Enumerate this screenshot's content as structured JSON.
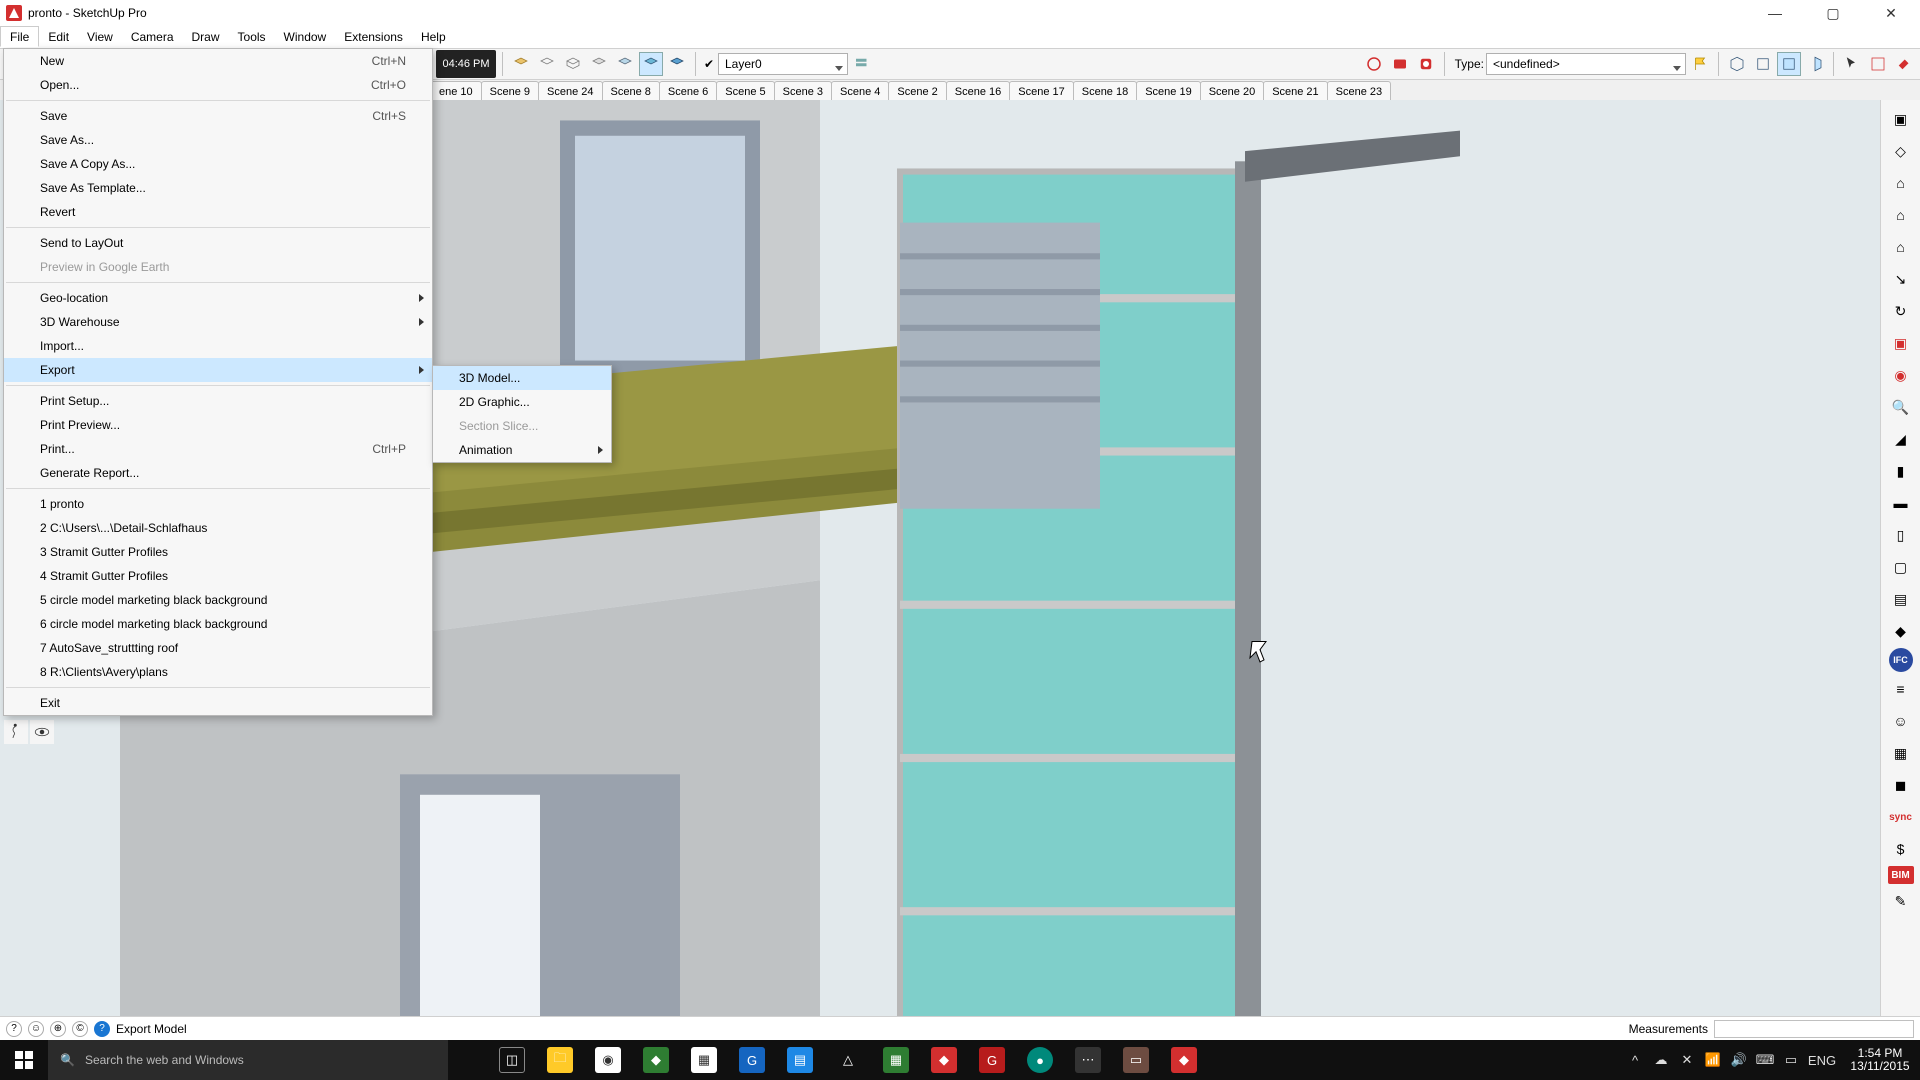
{
  "app": {
    "title": "pronto - SketchUp Pro",
    "status_hint": "Export Model",
    "measurements_label": "Measurements",
    "measurements_value": ""
  },
  "menubar": [
    "File",
    "Edit",
    "View",
    "Camera",
    "Draw",
    "Tools",
    "Window",
    "Extensions",
    "Help"
  ],
  "menubar_active_index": 0,
  "toolbar": {
    "time_display": "04:46 PM",
    "layer_checked": true,
    "layer_label": "Layer0",
    "type_label": "Type:",
    "type_value": "<undefined>"
  },
  "scene_tabs": [
    "ene 10",
    "Scene 9",
    "Scene 24",
    "Scene 8",
    "Scene 6",
    "Scene 5",
    "Scene 3",
    "Scene 4",
    "Scene 2",
    "Scene 16",
    "Scene 17",
    "Scene 18",
    "Scene 19",
    "Scene 20",
    "Scene 21",
    "Scene 23"
  ],
  "file_menu": {
    "groups": [
      [
        {
          "label": "New",
          "shortcut": "Ctrl+N"
        },
        {
          "label": "Open...",
          "shortcut": "Ctrl+O"
        }
      ],
      [
        {
          "label": "Save",
          "shortcut": "Ctrl+S"
        },
        {
          "label": "Save As..."
        },
        {
          "label": "Save A Copy As..."
        },
        {
          "label": "Save As Template..."
        },
        {
          "label": "Revert"
        }
      ],
      [
        {
          "label": "Send to LayOut"
        },
        {
          "label": "Preview in Google Earth",
          "disabled": true
        }
      ],
      [
        {
          "label": "Geo-location",
          "submenu": true
        },
        {
          "label": "3D Warehouse",
          "submenu": true
        },
        {
          "label": "Import..."
        },
        {
          "label": "Export",
          "submenu": true,
          "highlight": true
        }
      ],
      [
        {
          "label": "Print Setup..."
        },
        {
          "label": "Print Preview..."
        },
        {
          "label": "Print...",
          "shortcut": "Ctrl+P"
        },
        {
          "label": "Generate Report..."
        }
      ],
      [
        {
          "label": "1 pronto"
        },
        {
          "label": "2 C:\\Users\\...\\Detail-Schlafhaus"
        },
        {
          "label": "3 Stramit Gutter Profiles"
        },
        {
          "label": "4 Stramit Gutter Profiles"
        },
        {
          "label": "5 circle model marketing black background"
        },
        {
          "label": "6 circle model marketing black background"
        },
        {
          "label": "7 AutoSave_struttting roof"
        },
        {
          "label": "8 R:\\Clients\\Avery\\plans"
        }
      ],
      [
        {
          "label": "Exit"
        }
      ]
    ]
  },
  "export_submenu": [
    {
      "label": "3D Model...",
      "highlight": true
    },
    {
      "label": "2D Graphic..."
    },
    {
      "label": "Section Slice...",
      "disabled": true
    },
    {
      "label": "Animation",
      "submenu": true
    }
  ],
  "taskbar": {
    "search_placeholder": "Search the web and Windows",
    "lang": "ENG",
    "time": "1:54 PM",
    "date": "13/11/2015"
  }
}
